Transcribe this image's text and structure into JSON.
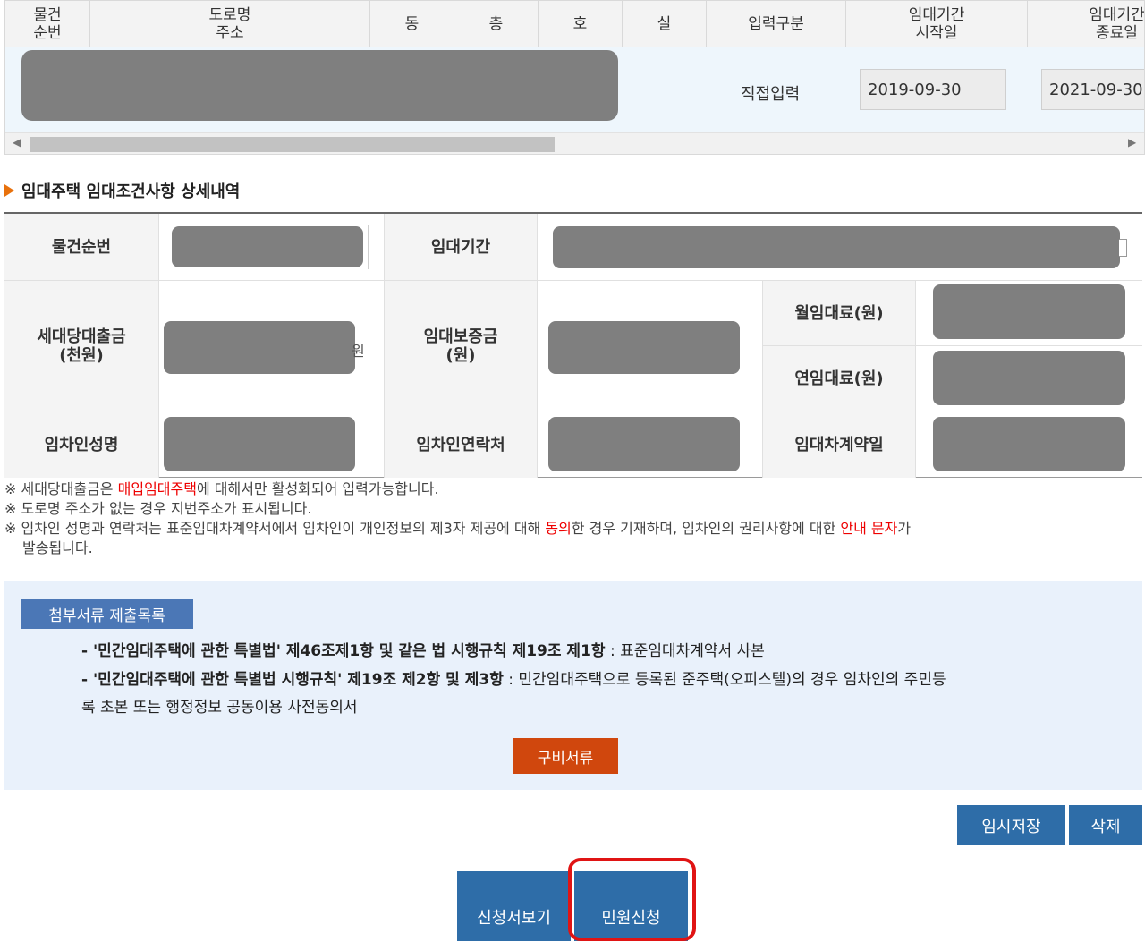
{
  "top_grid": {
    "headers": [
      "물건\n순번",
      "도로명\n주소",
      "동",
      "층",
      "호",
      "실",
      "입력구분",
      "임대기간\n시작일",
      "임대기간\n종료일"
    ],
    "row": {
      "input_type": "직접입력",
      "start_date": "2019-09-30",
      "end_date": "2021-09-30"
    }
  },
  "section_title": "임대주택 임대조건사항 상세내역",
  "detail": {
    "labels": {
      "property_no": "물건순번",
      "lease_period": "임대기간",
      "loan_per_household": "세대당대출금\n(천원)",
      "deposit": "임대보증금\n(원)",
      "monthly_rent": "월임대료(원)",
      "annual_rent": "연임대료(원)",
      "tenant_name": "임차인성명",
      "tenant_contact": "임차인연락처",
      "contract_date": "임대차계약일"
    },
    "loan_unit_fragment": "원"
  },
  "notes": {
    "n1_a": "※ 세대당대출금은 ",
    "n1_red": "매입임대주택",
    "n1_b": "에 대해서만 활성화되어 입력가능합니다.",
    "n2": "※ 도로명 주소가 없는 경우 지번주소가 표시됩니다.",
    "n3_a": "※ 임차인 성명과 연락처는 표준임대차계약서에서 임차인이 개인정보의 제3자 제공에 대해 ",
    "n3_red1": "동의",
    "n3_b": "한 경우 기재하며, 임차인의 권리사항에 대한 ",
    "n3_red2": "안내 문자",
    "n3_c": "가",
    "n3_d": "발송됩니다."
  },
  "attach": {
    "tag": "첨부서류 제출목록",
    "line1_bold": "- '민간임대주택에 관한 특별법' 제46조제1항 및 같은 법 시행규칙 제19조 제1항",
    "line1_rest": " : 표준임대차계약서 사본",
    "line2_bold": "- '민간임대주택에 관한 특별법 시행규칙' 제19조 제2항 및 제3항",
    "line2_rest": " : 민간임대주택으로 등록된 준주택(오피스텔)의 경우 임차인의 주민등",
    "line3": "록 초본 또는 행정정보 공동이용 사전동의서",
    "button": "구비서류"
  },
  "buttons": {
    "temp_save": "임시저장",
    "delete": "삭제",
    "view_application": "신청서보기",
    "submit_petition": "민원신청"
  },
  "colors": {
    "accent_blue": "#2e6da8",
    "accent_orange": "#d0470d",
    "highlight_red": "#e01414",
    "note_red": "#e00000"
  }
}
